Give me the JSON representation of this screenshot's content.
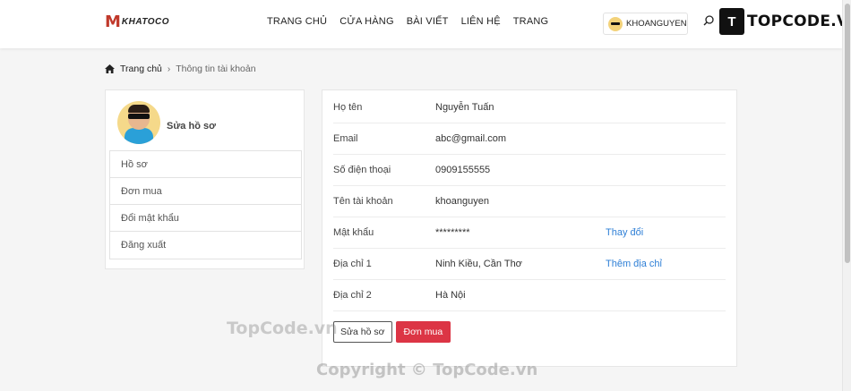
{
  "header": {
    "logo_mark": "M",
    "logo_text": "KHATOCO",
    "nav": [
      "TRANG CHỦ",
      "CỬA HÀNG",
      "BÀI VIẾT",
      "LIÊN HỆ",
      "TRANG"
    ],
    "username": "KHOANGUYEN",
    "badge_box": "T",
    "badge_text": "TOPCODE.VN"
  },
  "breadcrumb": {
    "home": "Trang chủ",
    "current": "Thông tin tài khoản"
  },
  "sidebar": {
    "edit_profile": "Sửa hồ sơ",
    "items": [
      "Hồ sơ",
      "Đơn mua",
      "Đổi mật khẩu",
      "Đăng xuất"
    ]
  },
  "profile": {
    "rows": [
      {
        "label": "Họ tên",
        "value": "Nguyễn Tuấn",
        "action": ""
      },
      {
        "label": "Email",
        "value": "abc@gmail.com",
        "action": ""
      },
      {
        "label": "Số điện thoại",
        "value": "0909155555",
        "action": ""
      },
      {
        "label": "Tên tài khoản",
        "value": "khoanguyen",
        "action": ""
      },
      {
        "label": "Mật khẩu",
        "value": "*********",
        "action": "Thay đổi"
      },
      {
        "label": "Địa chỉ 1",
        "value": "Ninh Kiều, Cần Thơ",
        "action": "Thêm địa chỉ"
      },
      {
        "label": "Địa chỉ 2",
        "value": "Hà Nội",
        "action": ""
      }
    ],
    "edit_button": "Sửa hồ sơ",
    "orders_button": "Đơn mua"
  },
  "watermarks": [
    "TopCode.vn",
    "Copyright © TopCode.vn"
  ],
  "colors": {
    "accent": "#dc3545",
    "link": "#2e7fd6"
  }
}
